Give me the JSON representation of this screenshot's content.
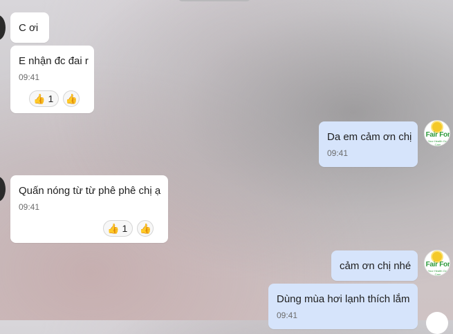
{
  "messages": [
    {
      "id": "m1",
      "side": "left",
      "text": "C ơi"
    },
    {
      "id": "m2",
      "side": "left",
      "text": "E nhận đc đai r",
      "time": "09:41",
      "reaction": {
        "icon": "thumbs-up",
        "count": "1"
      }
    },
    {
      "id": "m3",
      "side": "right",
      "text": "Da em cảm ơn chị",
      "time": "09:41"
    },
    {
      "id": "m4",
      "side": "left",
      "text": "Quấn nóng từ từ phê phê chị ạ",
      "time": "09:41",
      "reaction": {
        "icon": "thumbs-up",
        "count": "1"
      }
    },
    {
      "id": "m5",
      "side": "right",
      "text": "cảm ơn chị nhé"
    },
    {
      "id": "m6",
      "side": "right",
      "text": "Dùng mùa hơi lạnh thích lắm",
      "time": "09:41"
    }
  ],
  "brand": {
    "name": "Fair For",
    "tagline": "Your Health Our Care"
  },
  "icons": {
    "reaction": "thumbs-up-icon",
    "react_button": "thumbs-up-icon"
  },
  "colors": {
    "bubble_left": "#ffffff",
    "bubble_right": "#d6e4fb",
    "brand_green": "#2e9a3c"
  }
}
